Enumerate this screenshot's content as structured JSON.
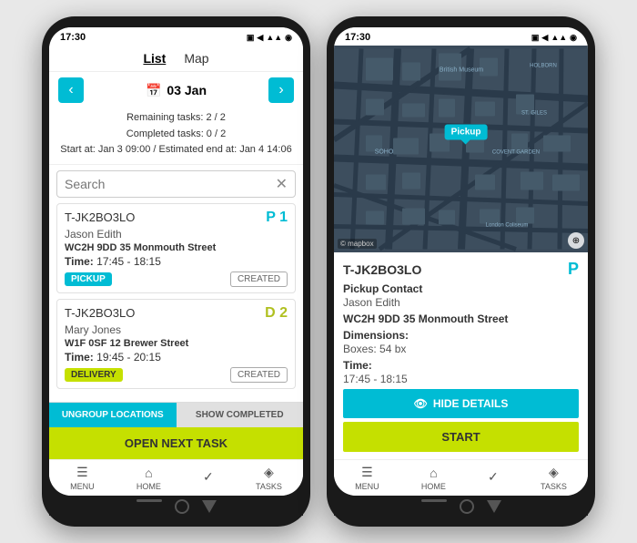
{
  "phone1": {
    "statusBar": {
      "time": "17:30",
      "icons": "▣ ✦ ◼ ▲ ▲ ◉"
    },
    "tabs": [
      {
        "label": "List",
        "active": true
      },
      {
        "label": "Map",
        "active": false
      }
    ],
    "date": "03 Jan",
    "taskInfo": {
      "remaining": "Remaining tasks: 2 / 2",
      "completed": "Completed tasks: 0 / 2",
      "startEnd": "Start at: Jan 3 09:00 / Estimated end at: Jan 4 14:06"
    },
    "search": {
      "placeholder": "Search"
    },
    "tasks": [
      {
        "id": "T-JK2BO3LO",
        "name": "Jason Edith",
        "postcode": "WC2H 9DD",
        "address": "35 Monmouth Street",
        "timeLabel": "Time:",
        "time": "17:45 - 18:15",
        "badgeType": "PICKUP",
        "status": "CREATED",
        "priority": "P 1"
      },
      {
        "id": "T-JK2BO3LO",
        "name": "Mary Jones",
        "postcode": "W1F 0SF",
        "address": "12 Brewer Street",
        "timeLabel": "Time:",
        "time": "19:45 - 20:15",
        "badgeType": "DELIVERY",
        "status": "CREATED",
        "priority": "D 2"
      }
    ],
    "buttons": {
      "ungroup": "UNGROUP LOCATIONS",
      "showCompleted": "SHOW COMPLETED",
      "openNextTask": "OPEN NEXT TASK"
    },
    "nav": [
      {
        "icon": "☰",
        "label": "MENU"
      },
      {
        "icon": "⌂",
        "label": "HOME"
      },
      {
        "icon": "✓",
        "label": ""
      },
      {
        "icon": "✦",
        "label": "TASKS"
      }
    ]
  },
  "phone2": {
    "statusBar": {
      "time": "17:30",
      "icons": "▣ ✦ ◼ ▲ ▲ ◉"
    },
    "mapLabels": {
      "britishMuseum": "British Museum",
      "holborn": "HOLBORN",
      "stGiles": "ST. GILES",
      "soho": "SOHO",
      "coventGarden": "COVENT GARDEN",
      "londonColiseum": "London Coliseum",
      "mapbox": "© mapbox"
    },
    "pickupPin": "Pickup",
    "detail": {
      "id": "T-JK2BO3LO",
      "priority": "P",
      "sectionTitle": "Pickup Contact",
      "name": "Jason Edith",
      "postcodeLabel": "WC2H 9DD",
      "address": "35 Monmouth Street",
      "dimensionsLabel": "Dimensions:",
      "dimensions": "Boxes: 54 bx",
      "timeLabel": "Time:",
      "time": "17:45 - 18:15"
    },
    "buttons": {
      "hideDetails": "HIDE DETAILS",
      "start": "START"
    },
    "nav": [
      {
        "icon": "☰",
        "label": "MENU"
      },
      {
        "icon": "⌂",
        "label": "HOME"
      },
      {
        "icon": "✓",
        "label": ""
      },
      {
        "icon": "✦",
        "label": "TASKS"
      }
    ]
  }
}
